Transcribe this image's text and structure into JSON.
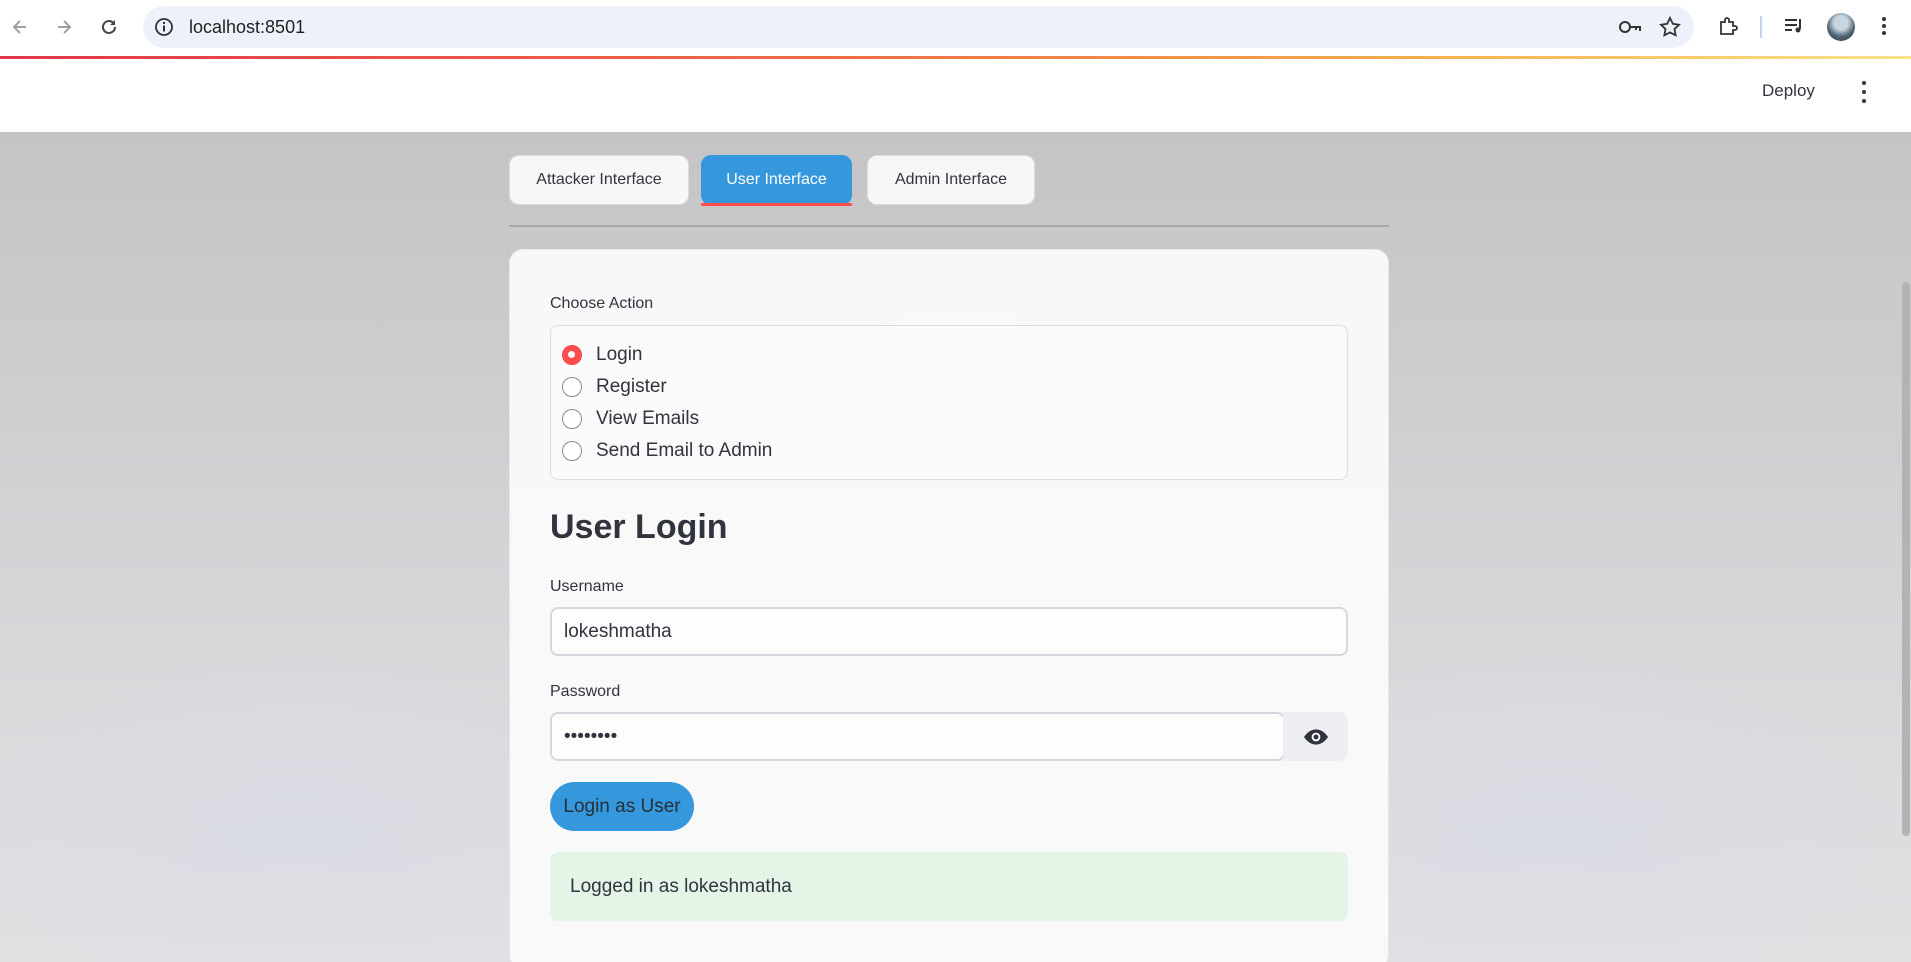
{
  "browser": {
    "url": "localhost:8501",
    "icons": [
      "back-arrow-icon",
      "forward-arrow-icon",
      "reload-icon",
      "site-info-icon",
      "password-key-icon",
      "bookmark-star-icon",
      "extensions-icon",
      "media-queue-icon",
      "profile-avatar",
      "chrome-menu-icon"
    ]
  },
  "header": {
    "deploy_label": "Deploy"
  },
  "tabs": [
    {
      "label": "Attacker Interface",
      "active": false
    },
    {
      "label": "User Interface",
      "active": true
    },
    {
      "label": "Admin Interface",
      "active": false
    }
  ],
  "action": {
    "label": "Choose Action",
    "options": [
      "Login",
      "Register",
      "View Emails",
      "Send Email to Admin"
    ],
    "selected": "Login"
  },
  "login": {
    "title": "User Login",
    "username_label": "Username",
    "username_value": "lokeshmatha",
    "password_label": "Password",
    "password_value": "••••••••",
    "submit_label": "Login as User",
    "success_message": "Logged in as lokeshmatha"
  },
  "colors": {
    "primary": "#3598dc",
    "accent": "#ff4b4b",
    "success_bg": "#e4f5e8"
  }
}
